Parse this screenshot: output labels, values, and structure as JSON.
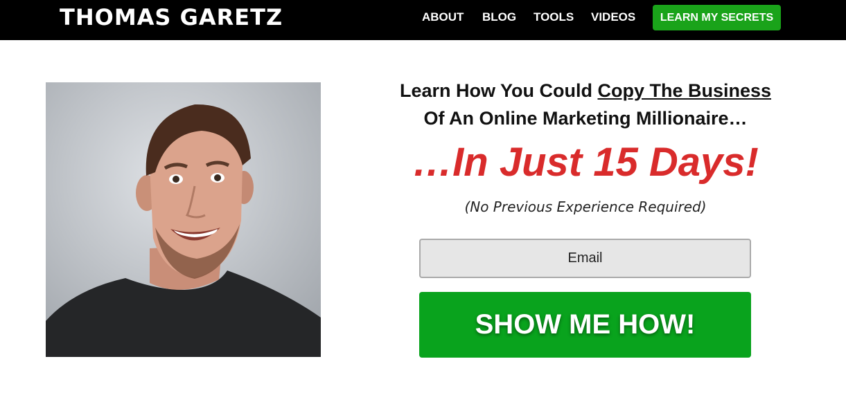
{
  "header": {
    "brand": "THOMAS GARETZ",
    "nav": [
      "ABOUT",
      "BLOG",
      "TOOLS",
      "VIDEOS"
    ],
    "cta_label": "LEARN MY SECRETS"
  },
  "hero": {
    "headline_line1_prefix": "Learn How You Could ",
    "headline_line1_underlined": "Copy The Business",
    "headline_line2": "Of An Online Marketing Millionaire…",
    "big_text": "…In Just 15 Days!",
    "subtext": "(No Previous Experience Required)",
    "email_placeholder": "Email",
    "button_label": "SHOW ME HOW!"
  },
  "colors": {
    "header_bg": "#000000",
    "nav_cta_bg": "#1aa31a",
    "headline_red": "#d92b2b",
    "button_green": "#09a31d",
    "input_bg": "#e6e6e6"
  },
  "icons": {
    "photo": "person-portrait"
  }
}
